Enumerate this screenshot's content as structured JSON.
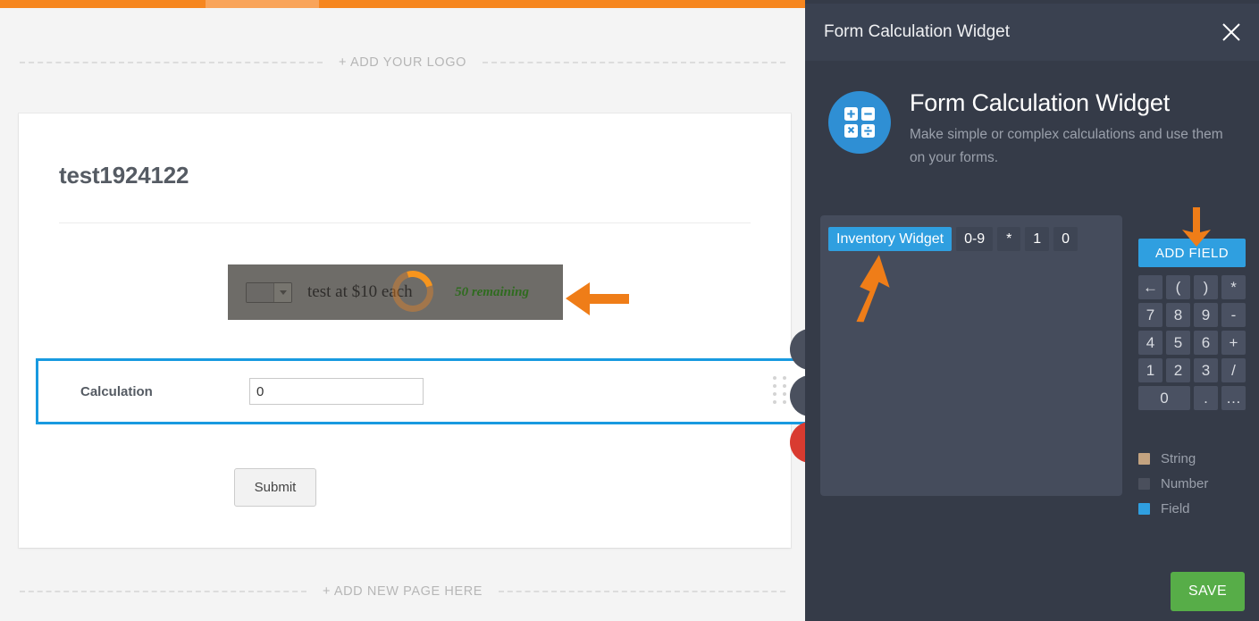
{
  "builder": {
    "add_logo_label": "+ ADD YOUR LOGO",
    "add_page_label": "+ ADD NEW PAGE HERE",
    "form_title": "test1924122",
    "inventory_row": {
      "product_label": "test at $10 each",
      "remaining_label": "50 remaining",
      "quantity_value": ""
    },
    "calculation_row": {
      "label": "Calculation",
      "value": "0"
    },
    "submit_label": "Submit"
  },
  "panel": {
    "header_title": "Form Calculation Widget",
    "close_label": "×",
    "hero": {
      "title": "Form Calculation Widget",
      "subtitle": "Make simple or complex calculations and use them on your forms."
    },
    "formula_tokens": [
      {
        "text": "Inventory Widget",
        "type": "field"
      },
      {
        "text": "0-9",
        "type": "number"
      },
      {
        "text": "*",
        "type": "number"
      },
      {
        "text": "1",
        "type": "number"
      },
      {
        "text": "0",
        "type": "number"
      }
    ],
    "add_field_label": "ADD FIELD",
    "keys": [
      {
        "label": "←",
        "name": "backspace"
      },
      {
        "label": "(",
        "name": "open-paren"
      },
      {
        "label": ")",
        "name": "close-paren"
      },
      {
        "label": "*",
        "name": "multiply"
      },
      {
        "label": "7",
        "name": "seven"
      },
      {
        "label": "8",
        "name": "eight"
      },
      {
        "label": "9",
        "name": "nine"
      },
      {
        "label": "-",
        "name": "minus"
      },
      {
        "label": "4",
        "name": "four"
      },
      {
        "label": "5",
        "name": "five"
      },
      {
        "label": "6",
        "name": "six"
      },
      {
        "label": "+",
        "name": "plus"
      },
      {
        "label": "1",
        "name": "one"
      },
      {
        "label": "2",
        "name": "two"
      },
      {
        "label": "3",
        "name": "three"
      },
      {
        "label": "/",
        "name": "divide"
      },
      {
        "label": "0",
        "name": "zero"
      },
      {
        "label": ".",
        "name": "decimal"
      },
      {
        "label": "…",
        "name": "more"
      }
    ],
    "legend": [
      {
        "label": "String",
        "color": "#c3a380"
      },
      {
        "label": "Number",
        "color": "#4a4f5c"
      },
      {
        "label": "Field",
        "color": "#2f9fe0"
      }
    ],
    "save_label": "SAVE"
  },
  "colors": {
    "brand_orange": "#f6861f",
    "panel_bg": "#353b48",
    "accent_blue": "#2f9fe0",
    "save_green": "#57ad48",
    "selection_blue": "#189ae0",
    "remaining_green": "#2f6b1f"
  }
}
